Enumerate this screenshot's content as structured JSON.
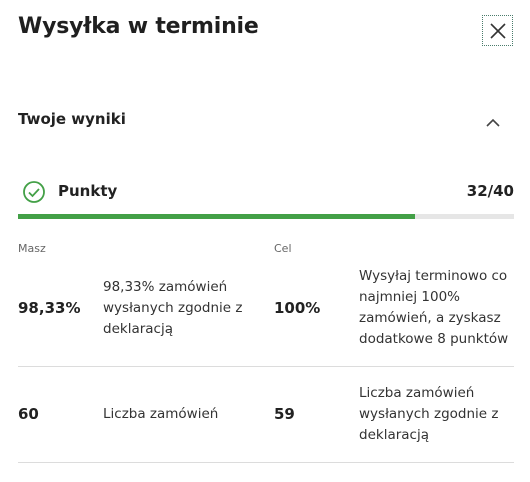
{
  "header": {
    "title": "Wysyłka w terminie",
    "close_icon": "close-icon"
  },
  "section": {
    "title": "Twoje wyniki",
    "collapse_icon": "chevron-up-icon"
  },
  "points": {
    "label": "Punkty",
    "value": "32/40",
    "progress": 0.8,
    "icon": "check-circle-icon",
    "accent_color": "#43a047"
  },
  "table": {
    "col_yours": "Masz",
    "col_target": "Cel",
    "rows": [
      {
        "value": "98,33%",
        "description": "98,33% zamówień wysłanych zgodnie z deklaracją",
        "target": "100%",
        "target_description": "Wysyłaj terminowo co najmniej 100% zamówień, a zyskasz dodatkowe 8 punktów"
      },
      {
        "value": "60",
        "description": "Liczba zamówień",
        "target": "59",
        "target_description": "Liczba zamówień wysłanych zgodnie z deklaracją"
      }
    ]
  }
}
